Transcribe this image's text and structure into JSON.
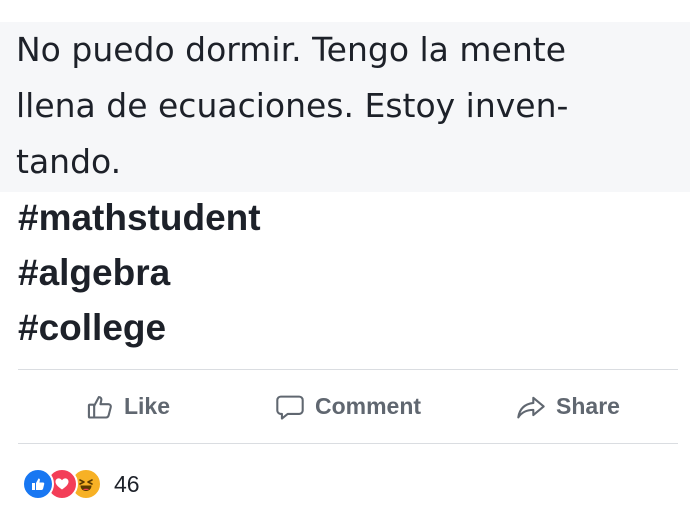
{
  "post": {
    "text_lines": [
      "No puedo dormir. Tengo la mente",
      "llena de ecuaciones. Estoy inven-",
      "tando."
    ],
    "hashtags": [
      "#mathstudent",
      "#algebra",
      "#college"
    ]
  },
  "actions": {
    "like_label": "Like",
    "comment_label": "Comment",
    "share_label": "Share"
  },
  "reactions": {
    "types": [
      "like-icon",
      "love-icon",
      "haha-icon"
    ],
    "count": "46"
  },
  "colors": {
    "text": "#1d2129",
    "action_gray": "#606770",
    "divider": "#dadde1",
    "like_blue": "#1877f2",
    "love_red": "#f33e58",
    "haha_yellow": "#f7b125"
  }
}
